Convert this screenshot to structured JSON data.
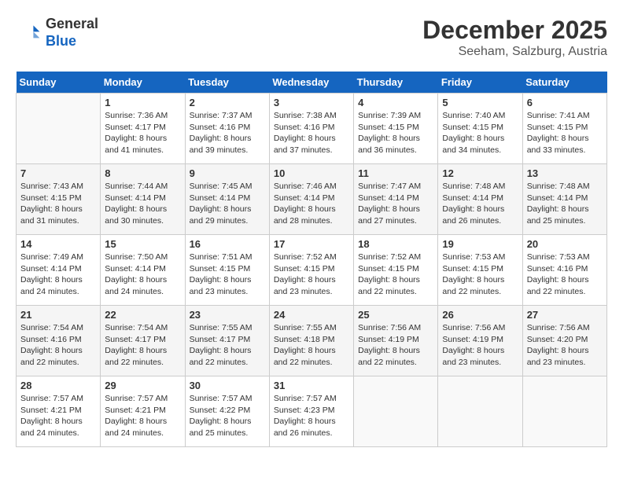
{
  "header": {
    "logo_line1": "General",
    "logo_line2": "Blue",
    "month_title": "December 2025",
    "subtitle": "Seeham, Salzburg, Austria"
  },
  "days_of_week": [
    "Sunday",
    "Monday",
    "Tuesday",
    "Wednesday",
    "Thursday",
    "Friday",
    "Saturday"
  ],
  "weeks": [
    [
      {
        "day": "",
        "empty": true
      },
      {
        "day": "1",
        "sunrise": "7:36 AM",
        "sunset": "4:17 PM",
        "daylight": "8 hours and 41 minutes."
      },
      {
        "day": "2",
        "sunrise": "7:37 AM",
        "sunset": "4:16 PM",
        "daylight": "8 hours and 39 minutes."
      },
      {
        "day": "3",
        "sunrise": "7:38 AM",
        "sunset": "4:16 PM",
        "daylight": "8 hours and 37 minutes."
      },
      {
        "day": "4",
        "sunrise": "7:39 AM",
        "sunset": "4:15 PM",
        "daylight": "8 hours and 36 minutes."
      },
      {
        "day": "5",
        "sunrise": "7:40 AM",
        "sunset": "4:15 PM",
        "daylight": "8 hours and 34 minutes."
      },
      {
        "day": "6",
        "sunrise": "7:41 AM",
        "sunset": "4:15 PM",
        "daylight": "8 hours and 33 minutes."
      }
    ],
    [
      {
        "day": "7",
        "sunrise": "7:43 AM",
        "sunset": "4:15 PM",
        "daylight": "8 hours and 31 minutes."
      },
      {
        "day": "8",
        "sunrise": "7:44 AM",
        "sunset": "4:14 PM",
        "daylight": "8 hours and 30 minutes."
      },
      {
        "day": "9",
        "sunrise": "7:45 AM",
        "sunset": "4:14 PM",
        "daylight": "8 hours and 29 minutes."
      },
      {
        "day": "10",
        "sunrise": "7:46 AM",
        "sunset": "4:14 PM",
        "daylight": "8 hours and 28 minutes."
      },
      {
        "day": "11",
        "sunrise": "7:47 AM",
        "sunset": "4:14 PM",
        "daylight": "8 hours and 27 minutes."
      },
      {
        "day": "12",
        "sunrise": "7:48 AM",
        "sunset": "4:14 PM",
        "daylight": "8 hours and 26 minutes."
      },
      {
        "day": "13",
        "sunrise": "7:48 AM",
        "sunset": "4:14 PM",
        "daylight": "8 hours and 25 minutes."
      }
    ],
    [
      {
        "day": "14",
        "sunrise": "7:49 AM",
        "sunset": "4:14 PM",
        "daylight": "8 hours and 24 minutes."
      },
      {
        "day": "15",
        "sunrise": "7:50 AM",
        "sunset": "4:14 PM",
        "daylight": "8 hours and 24 minutes."
      },
      {
        "day": "16",
        "sunrise": "7:51 AM",
        "sunset": "4:15 PM",
        "daylight": "8 hours and 23 minutes."
      },
      {
        "day": "17",
        "sunrise": "7:52 AM",
        "sunset": "4:15 PM",
        "daylight": "8 hours and 23 minutes."
      },
      {
        "day": "18",
        "sunrise": "7:52 AM",
        "sunset": "4:15 PM",
        "daylight": "8 hours and 22 minutes."
      },
      {
        "day": "19",
        "sunrise": "7:53 AM",
        "sunset": "4:15 PM",
        "daylight": "8 hours and 22 minutes."
      },
      {
        "day": "20",
        "sunrise": "7:53 AM",
        "sunset": "4:16 PM",
        "daylight": "8 hours and 22 minutes."
      }
    ],
    [
      {
        "day": "21",
        "sunrise": "7:54 AM",
        "sunset": "4:16 PM",
        "daylight": "8 hours and 22 minutes."
      },
      {
        "day": "22",
        "sunrise": "7:54 AM",
        "sunset": "4:17 PM",
        "daylight": "8 hours and 22 minutes."
      },
      {
        "day": "23",
        "sunrise": "7:55 AM",
        "sunset": "4:17 PM",
        "daylight": "8 hours and 22 minutes."
      },
      {
        "day": "24",
        "sunrise": "7:55 AM",
        "sunset": "4:18 PM",
        "daylight": "8 hours and 22 minutes."
      },
      {
        "day": "25",
        "sunrise": "7:56 AM",
        "sunset": "4:19 PM",
        "daylight": "8 hours and 22 minutes."
      },
      {
        "day": "26",
        "sunrise": "7:56 AM",
        "sunset": "4:19 PM",
        "daylight": "8 hours and 23 minutes."
      },
      {
        "day": "27",
        "sunrise": "7:56 AM",
        "sunset": "4:20 PM",
        "daylight": "8 hours and 23 minutes."
      }
    ],
    [
      {
        "day": "28",
        "sunrise": "7:57 AM",
        "sunset": "4:21 PM",
        "daylight": "8 hours and 24 minutes."
      },
      {
        "day": "29",
        "sunrise": "7:57 AM",
        "sunset": "4:21 PM",
        "daylight": "8 hours and 24 minutes."
      },
      {
        "day": "30",
        "sunrise": "7:57 AM",
        "sunset": "4:22 PM",
        "daylight": "8 hours and 25 minutes."
      },
      {
        "day": "31",
        "sunrise": "7:57 AM",
        "sunset": "4:23 PM",
        "daylight": "8 hours and 26 minutes."
      },
      {
        "day": "",
        "empty": true
      },
      {
        "day": "",
        "empty": true
      },
      {
        "day": "",
        "empty": true
      }
    ]
  ]
}
